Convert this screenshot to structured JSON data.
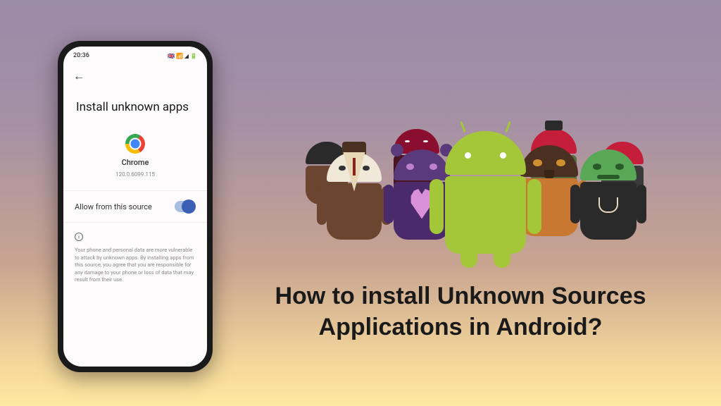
{
  "phone": {
    "status": {
      "time": "20:36",
      "icons": "🇬🇧 📶 ◢ 🔋"
    },
    "title": "Install unknown apps",
    "app": {
      "name": "Chrome",
      "version": "120.0.6099.115"
    },
    "toggle_label": "Allow from this source",
    "toggle_on": true,
    "warning": "Your phone and personal data are more vulnerable to attack by unknown apps. By installing apps from this source, you agree that you are responsible for any damage to your phone or loss of data that may result from their use."
  },
  "headline": "How to install Unknown Sources Applications in Android?"
}
